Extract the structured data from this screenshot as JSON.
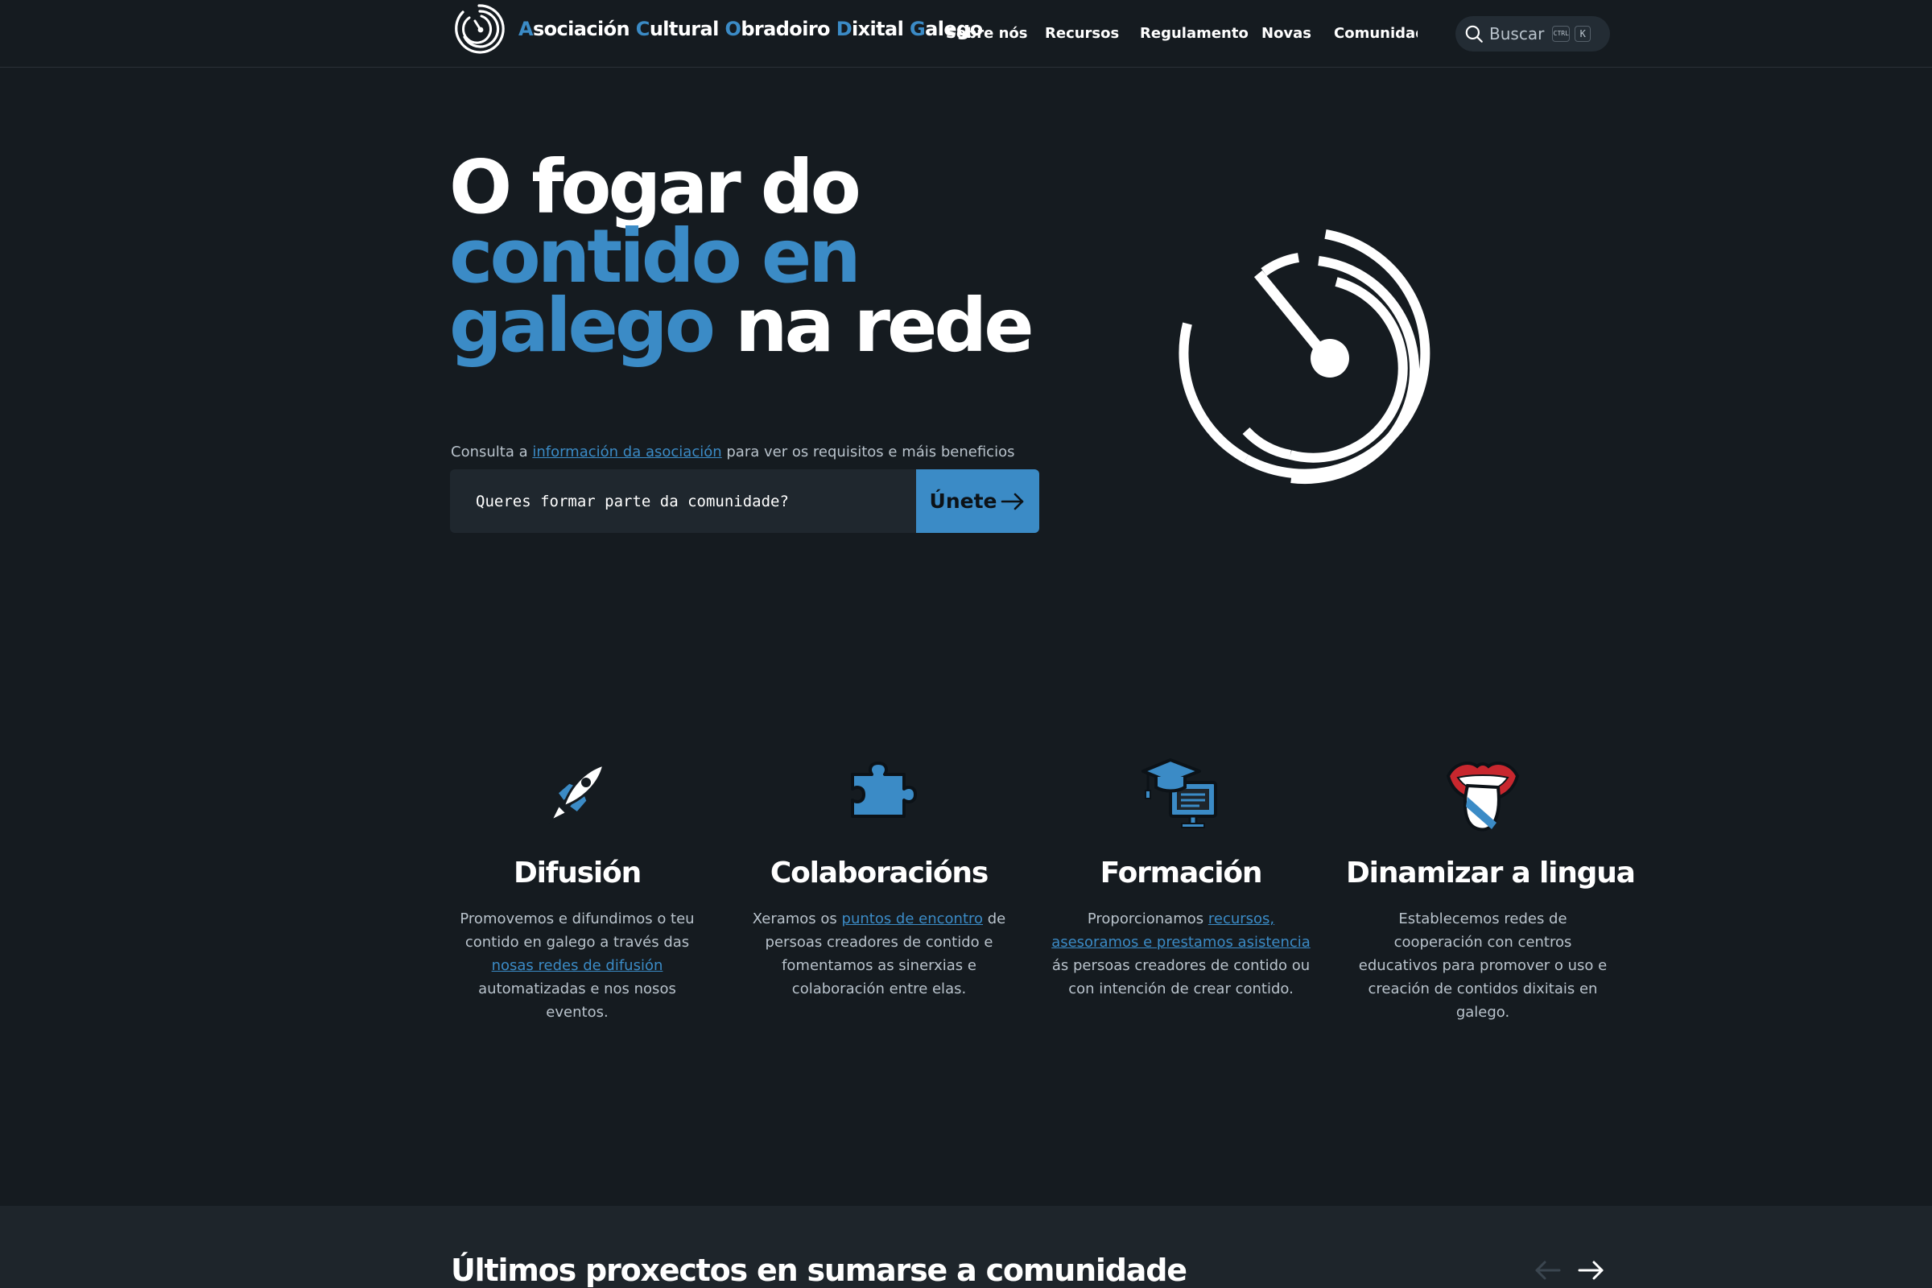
{
  "header": {
    "brand_parts": [
      {
        "accent": "A",
        "rest": "sociación "
      },
      {
        "accent": "C",
        "rest": "ultural "
      },
      {
        "accent": "O",
        "rest": "bradoiro "
      },
      {
        "accent": "D",
        "rest": "ixital "
      },
      {
        "accent": "G",
        "rest": "alego"
      }
    ],
    "nav": [
      "Sobre nós",
      "Recursos",
      "Regulamento",
      "Novas",
      "Comunidade"
    ],
    "search": {
      "label": "Buscar",
      "kbd_ctrl": "CTRL",
      "kbd_key": "K"
    }
  },
  "hero": {
    "title_line1": "O fogar do",
    "title_line2": "contido en",
    "title_line3_accent": "galego",
    "title_line3_rest": " na rede",
    "note_before": "Consulta a ",
    "note_link": "información da asociación",
    "note_after": " para ver os requisitos e máis beneficios",
    "join_placeholder": "Queres formar parte da comunidade?",
    "join_button": "Únete"
  },
  "features": [
    {
      "icon": "rocket-icon",
      "title": "Difusión",
      "parts": [
        {
          "t": "Promovemos e difundimos o teu contido en galego a través das "
        },
        {
          "t": "nosas redes de difusión",
          "link": true
        },
        {
          "t": " automatizadas e nos nosos eventos."
        }
      ]
    },
    {
      "icon": "puzzle-icon",
      "title": "Colaboracións",
      "parts": [
        {
          "t": "Xeramos os "
        },
        {
          "t": "puntos de encontro",
          "link": true
        },
        {
          "t": " de persoas creadores de contido e fomentamos as sinerxias e colaboración entre elas."
        }
      ]
    },
    {
      "icon": "graduation-cap-icon",
      "title": "Formación",
      "parts": [
        {
          "t": "Proporcionamos "
        },
        {
          "t": "recursos,",
          "link": true
        },
        {
          "t": " "
        },
        {
          "t": "asesoramos e prestamos asistencia",
          "link": true
        },
        {
          "t": " ás persoas creadores de contido ou con intención de crear contido."
        }
      ]
    },
    {
      "icon": "galician-tongue-icon",
      "title": "Dinamizar a lingua",
      "parts": [
        {
          "t": "Establecemos redes de cooperación con centros educativos para promover o uso e creación de contidos dixitais en galego."
        }
      ]
    }
  ],
  "projects": {
    "title": "Últimos proxectos en sumarse a comunidade"
  },
  "colors": {
    "accent": "#3b8bc6",
    "background": "#151b20",
    "red": "#c8272e"
  }
}
